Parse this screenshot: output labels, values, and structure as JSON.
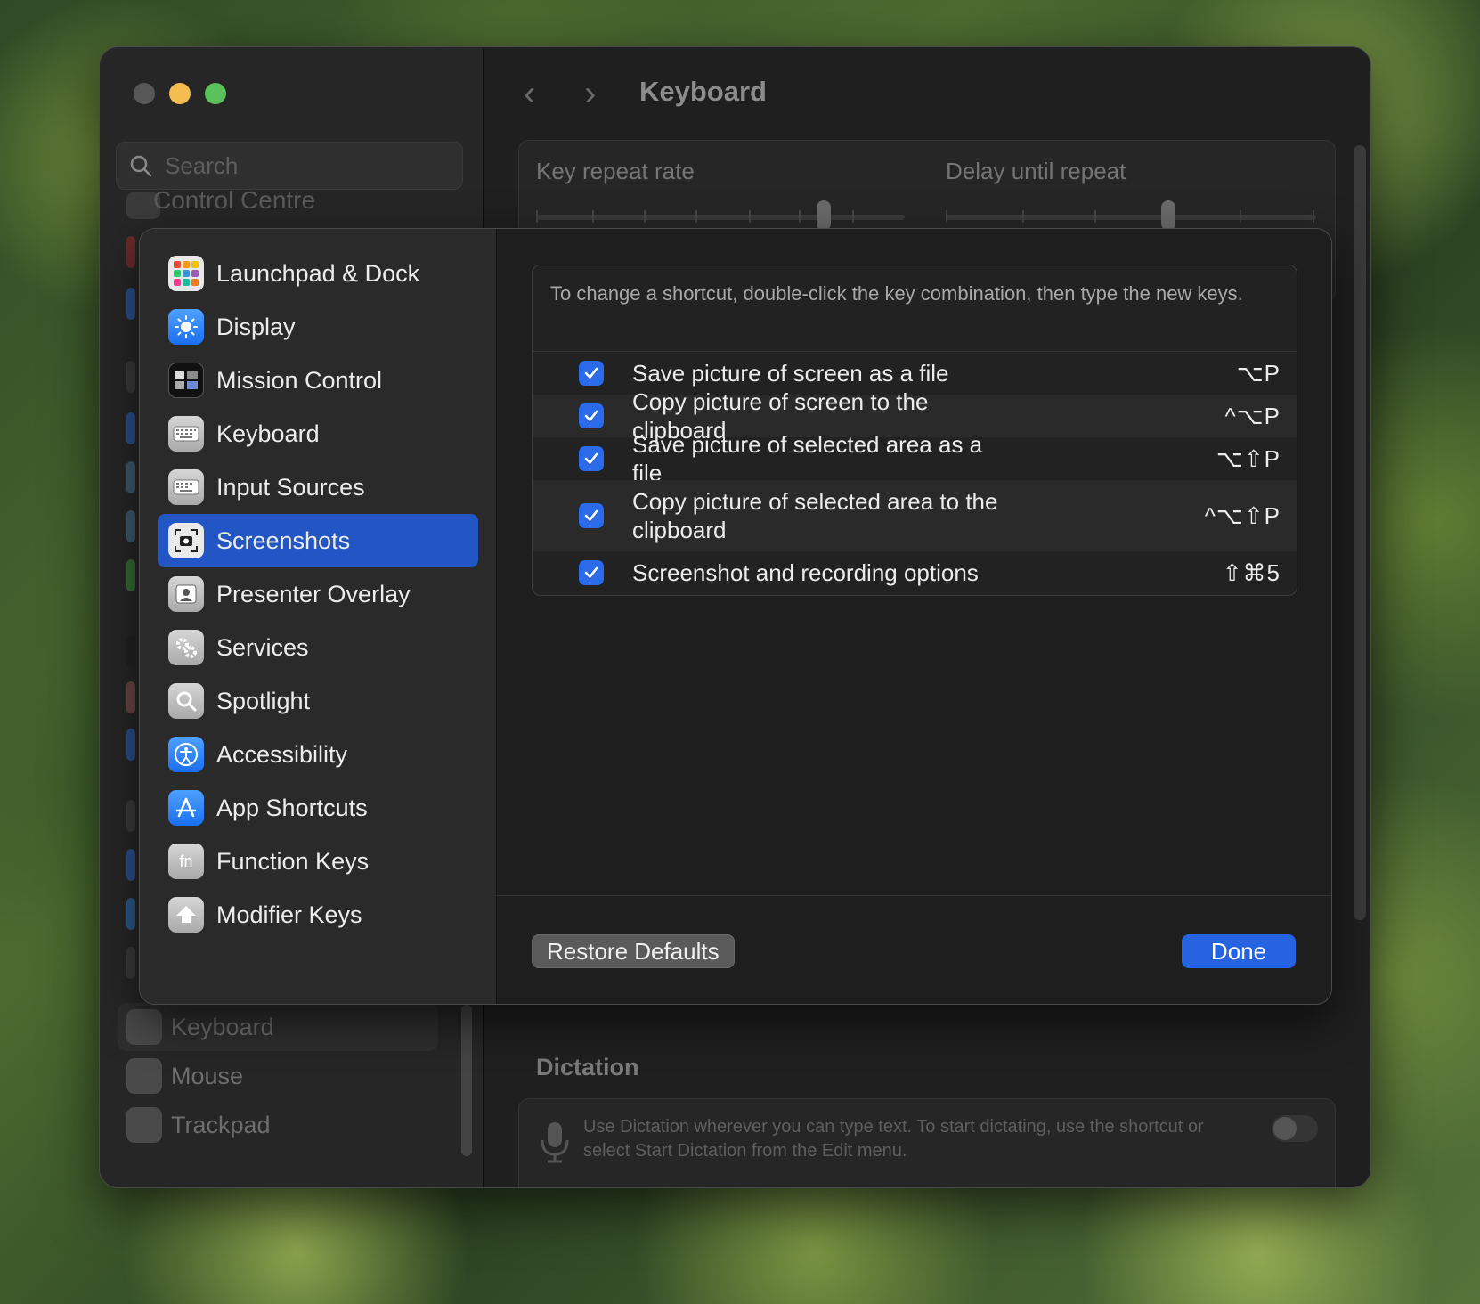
{
  "window": {
    "title": "Keyboard",
    "search_placeholder": "Search",
    "bg_sidebar_partial": "Control Centre",
    "bg_sidebar_items": [
      {
        "label": "Keyboard",
        "icon": "keyboard-icon",
        "selected": true
      },
      {
        "label": "Mouse",
        "icon": "mouse-icon",
        "selected": false
      },
      {
        "label": "Trackpad",
        "icon": "trackpad-icon",
        "selected": false
      }
    ]
  },
  "keyboard_settings": {
    "key_repeat_label": "Key repeat rate",
    "delay_label": "Delay until repeat",
    "key_repeat_level": 0.78,
    "delay_level": 0.6,
    "dictation_title": "Dictation",
    "dictation_text": "Use Dictation wherever you can type text. To start dictating, use the shortcut or select Start Dictation from the Edit menu.",
    "dictation_enabled": false
  },
  "sheet": {
    "categories": [
      {
        "label": "Launchpad & Dock",
        "icon": "launchpad-icon"
      },
      {
        "label": "Display",
        "icon": "display-icon"
      },
      {
        "label": "Mission Control",
        "icon": "mission-control-icon"
      },
      {
        "label": "Keyboard",
        "icon": "keyboard-icon"
      },
      {
        "label": "Input Sources",
        "icon": "input-sources-icon"
      },
      {
        "label": "Screenshots",
        "icon": "screenshots-icon",
        "selected": true
      },
      {
        "label": "Presenter Overlay",
        "icon": "presenter-overlay-icon"
      },
      {
        "label": "Services",
        "icon": "services-icon"
      },
      {
        "label": "Spotlight",
        "icon": "spotlight-icon"
      },
      {
        "label": "Accessibility",
        "icon": "accessibility-icon"
      },
      {
        "label": "App Shortcuts",
        "icon": "app-shortcuts-icon"
      },
      {
        "label": "Function Keys",
        "icon": "function-keys-icon"
      },
      {
        "label": "Modifier Keys",
        "icon": "modifier-keys-icon"
      }
    ],
    "instructions": "To change a shortcut, double-click the key combination, then type the new keys.",
    "shortcuts": [
      {
        "label": "Save picture of screen as a file",
        "keys": "⌥P",
        "checked": true
      },
      {
        "label": "Copy picture of screen to the clipboard",
        "keys": "^⌥P",
        "checked": true
      },
      {
        "label": "Save picture of selected area as a file",
        "keys": "⌥⇧P",
        "checked": true
      },
      {
        "label": "Copy picture of selected area to the clipboard",
        "keys": "^⌥⇧P",
        "checked": true
      },
      {
        "label": "Screenshot and recording options",
        "keys": "⇧⌘5",
        "checked": true
      }
    ],
    "restore_label": "Restore Defaults",
    "done_label": "Done",
    "accent_color": "#2563e0"
  }
}
